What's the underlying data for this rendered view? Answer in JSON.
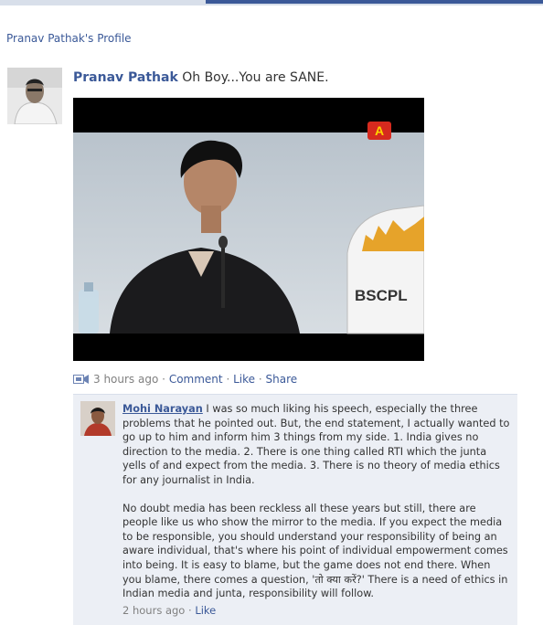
{
  "breadcrumb": {
    "label": "Pranav Pathak's Profile"
  },
  "post": {
    "author": "Pranav Pathak",
    "text": "Oh Boy...You are SANE.",
    "video": {
      "channel_logo": "A",
      "banner_text": "BSCPL"
    },
    "time": "3 hours ago",
    "actions": {
      "comment": "Comment",
      "like": "Like",
      "share": "Share"
    }
  },
  "comment": {
    "author": "Mohi Narayan",
    "paragraph1": "I was so much liking his speech, especially the three problems that he pointed out. But, the end statement, I actually wanted to go up to him and inform him 3 things from my side. 1. India gives no direction to the media. 2. There is one thing called RTI which the junta yells of and expect from the media. 3. There is no theory of media ethics for any journalist in India.",
    "paragraph2": "No doubt media has been reckless all these years but still, there are people like us who show the mirror to the media. If you expect the media to be responsible, you should understand your responsibility of being an aware individual, that's where his point of individual empowerment comes into being. It is easy to blame, but the game does not end there. When you blame, there comes a question, 'तो क्या करें?' There is a need of ethics in Indian media and junta, responsibility will follow.",
    "time": "2 hours ago",
    "like": "Like"
  },
  "colors": {
    "link": "#3b5998",
    "comment_bg": "#eceff5",
    "meta": "#808080"
  },
  "icons": {
    "post_type": "video-post-icon"
  }
}
